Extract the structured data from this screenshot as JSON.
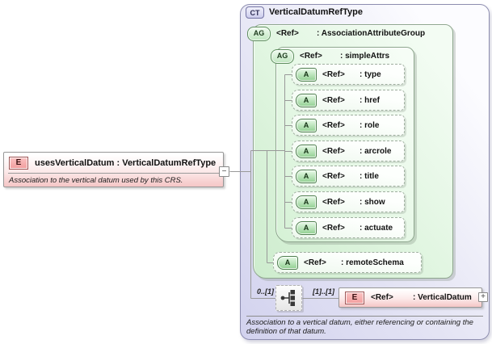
{
  "element": {
    "badge": "E",
    "title": "usesVerticalDatum : VerticalDatumRefType",
    "annotation": "Association to the vertical datum used by this CRS.",
    "collapse_glyph": "−"
  },
  "complex_type": {
    "badge": "CT",
    "title": "VerticalDatumRefType",
    "annotation": "Association to a vertical datum, either referencing or containing the definition of that datum.",
    "attribute_group": {
      "badge": "AG",
      "ref": "<Ref>",
      "name": ": AssociationAttributeGroup",
      "simple_attrs": {
        "badge": "AG",
        "ref": "<Ref>",
        "name": ": simpleAttrs",
        "attributes": [
          {
            "badge": "A",
            "ref": "<Ref>",
            "name": ": type"
          },
          {
            "badge": "A",
            "ref": "<Ref>",
            "name": ": href"
          },
          {
            "badge": "A",
            "ref": "<Ref>",
            "name": ": role"
          },
          {
            "badge": "A",
            "ref": "<Ref>",
            "name": ": arcrole"
          },
          {
            "badge": "A",
            "ref": "<Ref>",
            "name": ": title"
          },
          {
            "badge": "A",
            "ref": "<Ref>",
            "name": ": show"
          },
          {
            "badge": "A",
            "ref": "<Ref>",
            "name": ": actuate"
          }
        ]
      },
      "remote_schema": {
        "badge": "A",
        "ref": "<Ref>",
        "name": ": remoteSchema"
      }
    },
    "content_model": {
      "compositor": "sequence",
      "cardinality_before": "0..[1]",
      "cardinality_after": "[1]..[1]",
      "child_element": {
        "badge": "E",
        "ref": "<Ref>",
        "name": ": VerticalDatum",
        "expand_glyph": "+"
      }
    }
  },
  "colors": {
    "element_fill": "#f5c6c6",
    "element_badge": "#f19d9d",
    "group_fill": "#d8f3d8",
    "attribute_badge": "#90cf90",
    "complex_type_fill": "#d2d2ee",
    "connector": "#999999"
  }
}
